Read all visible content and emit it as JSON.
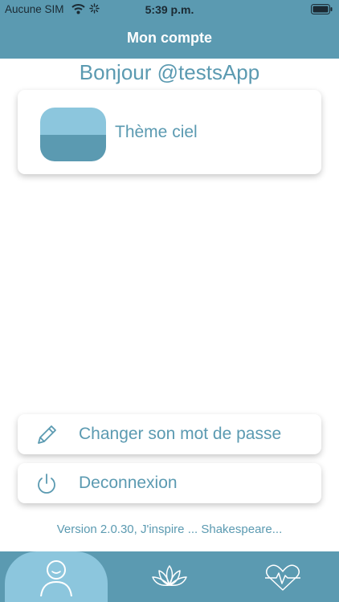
{
  "status_bar": {
    "carrier": "Aucune SIM",
    "time": "5:39 p.m."
  },
  "header": {
    "title": "Mon compte"
  },
  "greeting": "Bonjour @testsApp",
  "theme": {
    "label": "Thème ciel",
    "colors": {
      "top": "#8cc6dd",
      "bottom": "#5b9ab1"
    }
  },
  "actions": {
    "change_password": {
      "label": "Changer son mot de passe",
      "icon": "pencil-icon"
    },
    "logout": {
      "label": "Deconnexion",
      "icon": "power-icon"
    }
  },
  "version": "Version 2.0.30, J'inspire ... Shakespeare...",
  "tab_bar": {
    "tabs": [
      {
        "icon": "user-icon",
        "active": true
      },
      {
        "icon": "lotus-icon",
        "active": false
      },
      {
        "icon": "heart-pulse-icon",
        "active": false
      }
    ]
  },
  "colors": {
    "primary": "#5b9ab1",
    "primary_light": "#8cc6dd",
    "background": "#ffffff"
  }
}
